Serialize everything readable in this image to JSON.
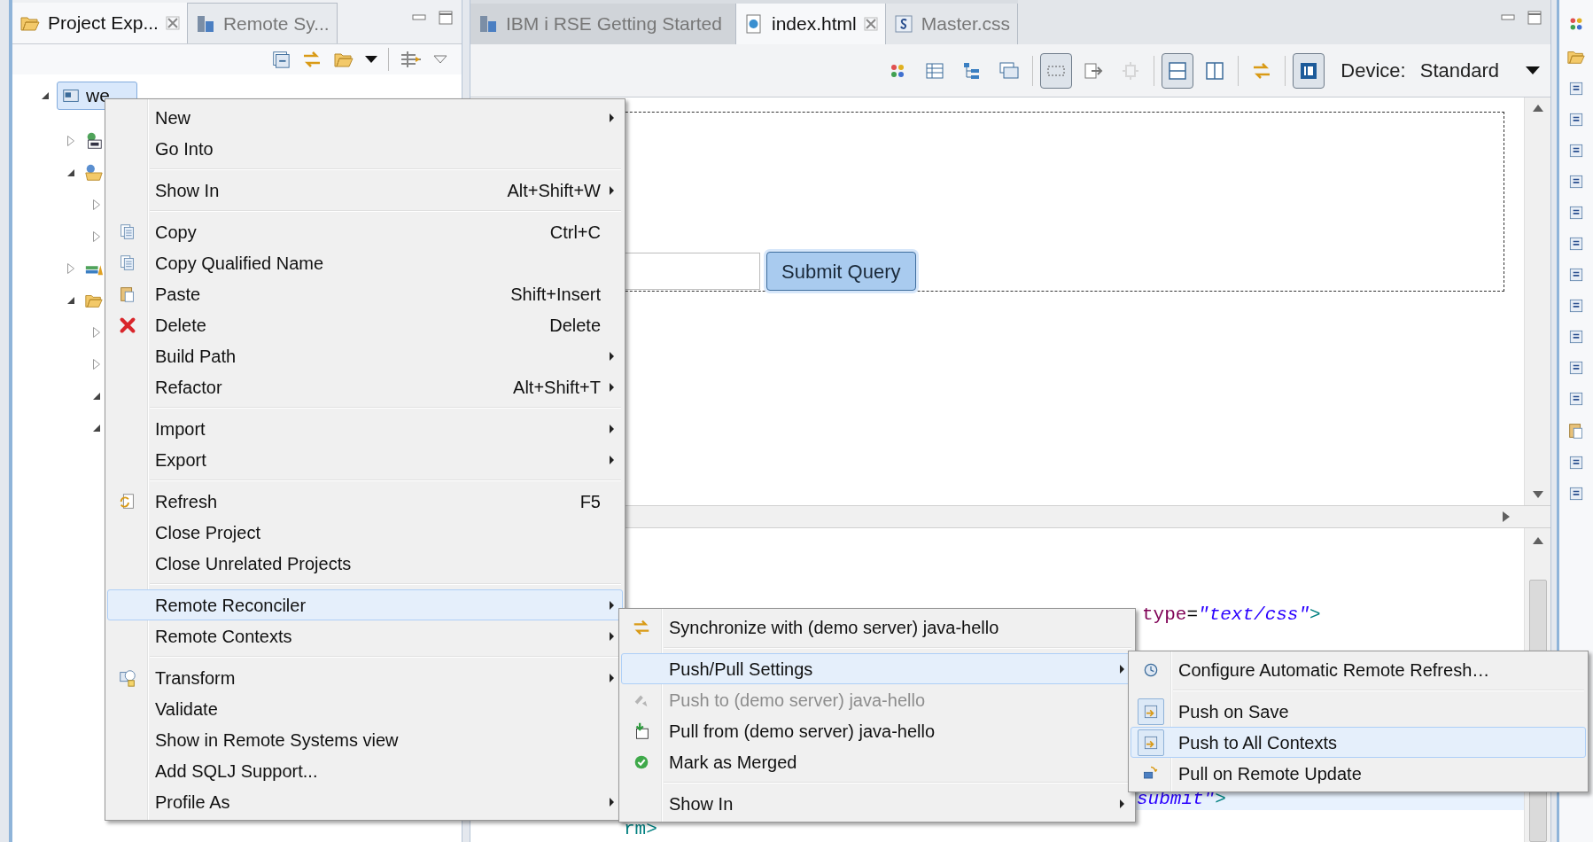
{
  "explorer": {
    "tabs": [
      {
        "label": "Project Exp...",
        "selected": true
      },
      {
        "label": "Remote Sy...",
        "selected": false
      }
    ],
    "tree": [
      {
        "label": "we",
        "kind": "project",
        "selected": true,
        "expanded": true,
        "children": [
          {
            "kind": "facet",
            "expanded": false
          },
          {
            "kind": "web-resources",
            "expanded": true,
            "children": [
              {
                "expanded": false
              },
              {
                "expanded": false
              }
            ]
          },
          {
            "kind": "books",
            "expanded": false
          },
          {
            "kind": "open-folder",
            "expanded": true,
            "children": [
              {
                "expanded": false
              },
              {
                "expanded": false
              },
              {
                "expanded": true
              },
              {
                "expanded": true
              }
            ]
          }
        ]
      }
    ]
  },
  "editor": {
    "tabs": [
      {
        "label": "IBM i RSE Getting Started",
        "kind": "rse",
        "selected": false
      },
      {
        "label": "index.html",
        "kind": "html",
        "selected": true
      },
      {
        "label": "Master.css",
        "kind": "css",
        "selected": false
      }
    ],
    "toolbar": [
      {
        "kind": "palette",
        "pressed": false
      },
      {
        "kind": "table",
        "pressed": false
      },
      {
        "kind": "outline",
        "pressed": false
      },
      {
        "kind": "windows",
        "pressed": false
      },
      {
        "kind": "separator"
      },
      {
        "kind": "frame",
        "pressed": true
      },
      {
        "kind": "export",
        "pressed": false
      },
      {
        "kind": "component",
        "pressed": false,
        "disabled": true
      },
      {
        "kind": "separator"
      },
      {
        "kind": "split-horizontal",
        "pressed": true
      },
      {
        "kind": "split-vertical",
        "pressed": false
      },
      {
        "kind": "separator"
      },
      {
        "kind": "sync",
        "pressed": false
      },
      {
        "kind": "separator"
      },
      {
        "kind": "browser",
        "pressed": true
      }
    ],
    "device_label": "Device:",
    "device_value": "Standard",
    "design": {
      "button": "Submit Query"
    },
    "source": [
      {
        "current": false,
        "parts": [
          {
            "kind": "attr",
            "text": "type"
          },
          {
            "kind": "eq",
            "text": "="
          },
          {
            "kind": "value",
            "text": "\"text/css\""
          },
          {
            "kind": "tag",
            "text": ">"
          }
        ]
      },
      {
        "current": true,
        "parts": [
          {
            "kind": "value",
            "text": "submit\""
          },
          {
            "kind": "tag",
            "text": ">"
          }
        ]
      },
      {
        "current": false,
        "parts": [
          {
            "kind": "tag",
            "text": "rm>"
          }
        ]
      }
    ]
  },
  "context_menu": {
    "items": [
      {
        "kind": "item",
        "label": "New",
        "submenu": true,
        "selected": false
      },
      {
        "kind": "item",
        "label": "Go Into",
        "selected": false
      },
      {
        "kind": "separator"
      },
      {
        "kind": "item",
        "label": "Show In",
        "shortcut": "Alt+Shift+W",
        "submenu": true,
        "selected": false
      },
      {
        "kind": "separator"
      },
      {
        "kind": "item",
        "label": "Copy",
        "shortcut": "Ctrl+C",
        "selected": false
      },
      {
        "kind": "item",
        "label": "Copy Qualified Name",
        "selected": false
      },
      {
        "kind": "item",
        "label": "Paste",
        "shortcut": "Shift+Insert",
        "selected": false
      },
      {
        "kind": "item",
        "label": "Delete",
        "shortcut": "Delete",
        "selected": false
      },
      {
        "kind": "item",
        "label": "Build Path",
        "submenu": true,
        "selected": false
      },
      {
        "kind": "item",
        "label": "Refactor",
        "shortcut": "Alt+Shift+T",
        "submenu": true,
        "selected": false
      },
      {
        "kind": "separator"
      },
      {
        "kind": "item",
        "label": "Import",
        "submenu": true,
        "selected": false
      },
      {
        "kind": "item",
        "label": "Export",
        "submenu": true,
        "selected": false
      },
      {
        "kind": "separator"
      },
      {
        "kind": "item",
        "label": "Refresh",
        "shortcut": "F5",
        "selected": false
      },
      {
        "kind": "item",
        "label": "Close Project",
        "selected": false
      },
      {
        "kind": "item",
        "label": "Close Unrelated Projects",
        "selected": false
      },
      {
        "kind": "separator"
      },
      {
        "kind": "item",
        "label": "Remote Reconciler",
        "submenu": true,
        "selected": true
      },
      {
        "kind": "item",
        "label": "Remote Contexts",
        "submenu": true,
        "selected": false
      },
      {
        "kind": "separator"
      },
      {
        "kind": "item",
        "label": "Transform",
        "submenu": true,
        "selected": false
      },
      {
        "kind": "item",
        "label": "Validate",
        "selected": false
      },
      {
        "kind": "item",
        "label": "Show in Remote Systems view",
        "selected": false
      },
      {
        "kind": "item",
        "label": "Add SQLJ Support...",
        "selected": false
      },
      {
        "kind": "item",
        "label": "Profile As",
        "submenu": true,
        "selected": false
      }
    ]
  },
  "reconciler_menu": {
    "items": [
      {
        "kind": "item",
        "label": "Synchronize with (demo server) java-hello",
        "selected": false,
        "disabled": false
      },
      {
        "kind": "separator"
      },
      {
        "kind": "item",
        "label": "Push/Pull Settings",
        "submenu": true,
        "selected": true,
        "disabled": false
      },
      {
        "kind": "item",
        "label": "Push to (demo server) java-hello",
        "selected": false,
        "disabled": true
      },
      {
        "kind": "item",
        "label": "Pull from (demo server) java-hello",
        "selected": false,
        "disabled": false
      },
      {
        "kind": "item",
        "label": "Mark as Merged",
        "selected": false,
        "disabled": false
      },
      {
        "kind": "separator"
      },
      {
        "kind": "item",
        "label": "Show In",
        "submenu": true,
        "selected": false,
        "disabled": false
      }
    ]
  },
  "settings_menu": {
    "items": [
      {
        "kind": "item",
        "label": "Configure Automatic Remote Refresh…",
        "checked": false,
        "selected": false
      },
      {
        "kind": "separator"
      },
      {
        "kind": "item",
        "label": "Push on Save",
        "checked": true,
        "selected": false
      },
      {
        "kind": "item",
        "label": "Push to All Contexts",
        "checked": true,
        "selected": true
      },
      {
        "kind": "item",
        "label": "Pull on Remote Update",
        "checked": false,
        "selected": false
      }
    ]
  }
}
